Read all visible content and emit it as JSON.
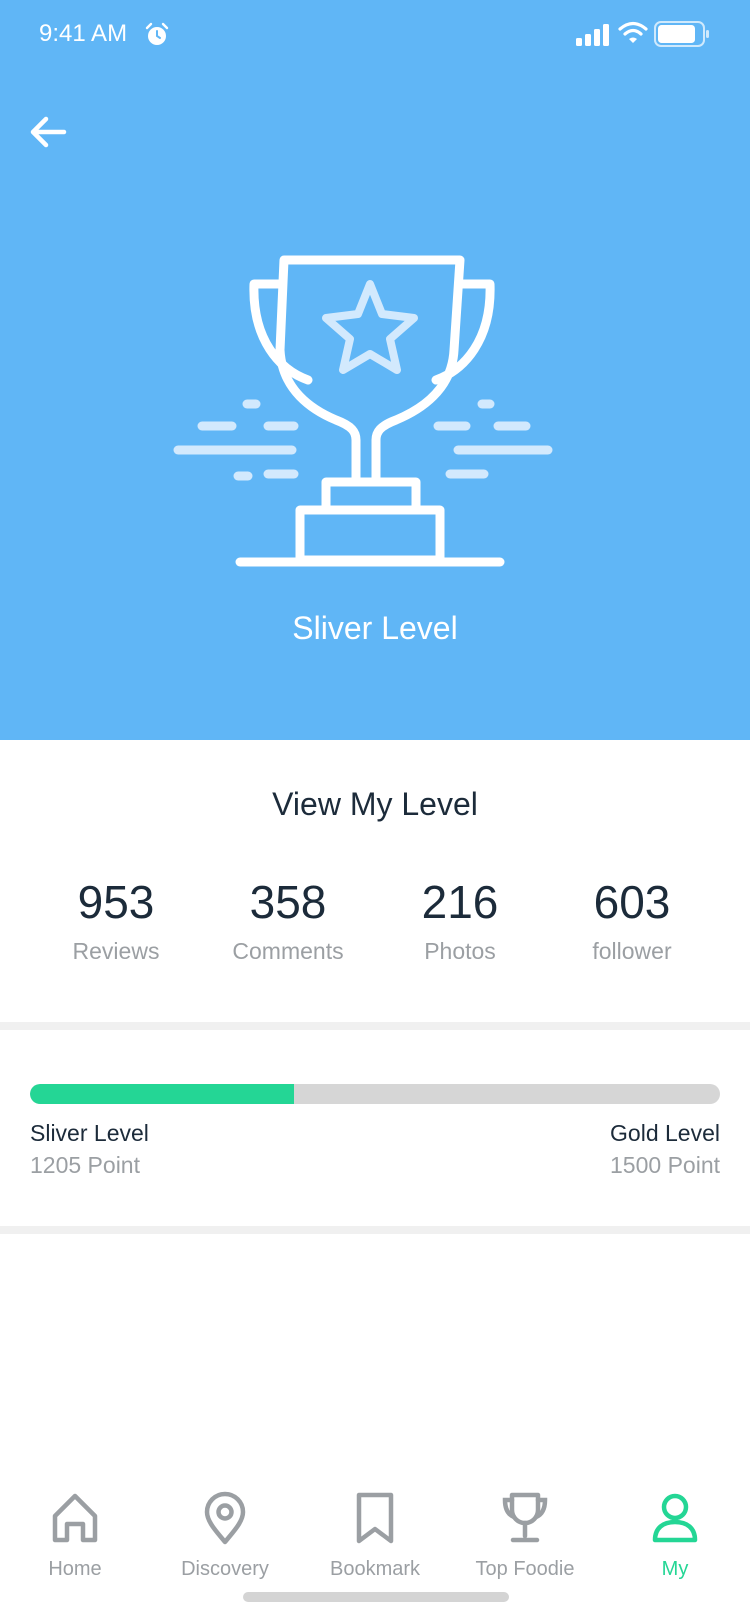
{
  "status_bar": {
    "time": "9:41 AM"
  },
  "hero": {
    "level_name": "Sliver Level"
  },
  "section_title": "View My Level",
  "stats": [
    {
      "value": "953",
      "label": "Reviews"
    },
    {
      "value": "358",
      "label": "Comments"
    },
    {
      "value": "216",
      "label": "Photos"
    },
    {
      "value": "603",
      "label": "follower"
    }
  ],
  "progress": {
    "fraction": 0.383,
    "current_level": "Sliver Level",
    "current_points": "1205 Point",
    "next_level": "Gold Level",
    "next_points": "1500 Point"
  },
  "tabs": [
    {
      "label": "Home",
      "icon": "home-icon"
    },
    {
      "label": "Discovery",
      "icon": "location-pin-icon"
    },
    {
      "label": "Bookmark",
      "icon": "bookmark-icon"
    },
    {
      "label": "Top Foodie",
      "icon": "trophy-icon"
    },
    {
      "label": "My",
      "icon": "user-icon",
      "active": true
    }
  ],
  "colors": {
    "header": "#60B6F6",
    "accent": "#24D695",
    "text_dark": "#1C2B3A",
    "text_muted": "#9B9FA3",
    "track": "#D6D6D6"
  }
}
